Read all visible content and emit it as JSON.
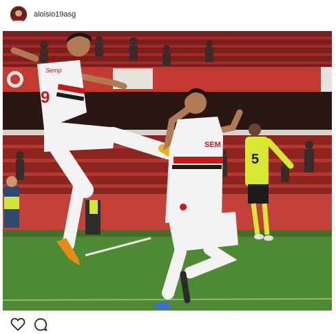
{
  "post": {
    "username": "aloisio19asg",
    "avatar": "avatar",
    "photo": {
      "description_icon": "photo-icon",
      "sponsor_left": "Semp",
      "shirt_number_left": "9",
      "shirt_number_right": "5",
      "sponsor_right": "SEM"
    }
  },
  "actions": {
    "like_icon": "heart-icon",
    "comment_icon": "comment-icon"
  },
  "colors": {
    "text": "#262626",
    "pitch": "#4e8a34",
    "stands": "#c0302c",
    "jersey_white": "#f3f3f3",
    "jersey_red": "#c51a1a",
    "keeper_yellow": "#d8e832"
  }
}
